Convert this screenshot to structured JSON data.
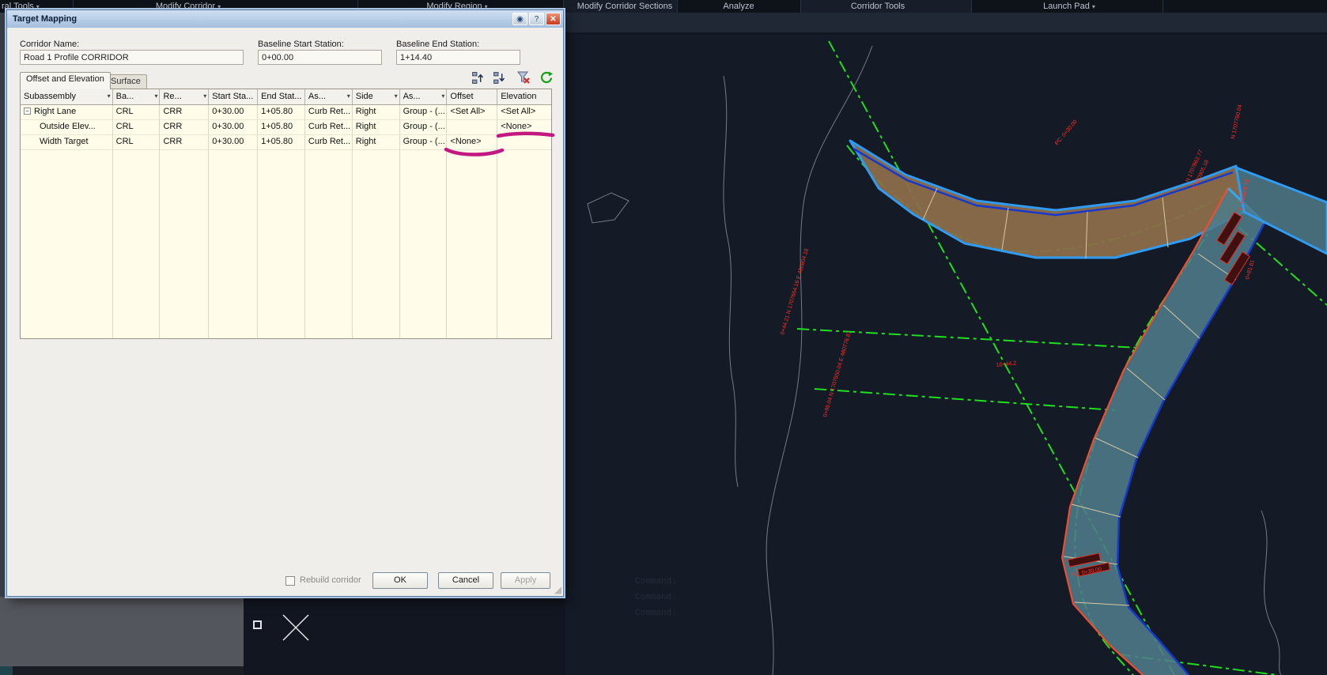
{
  "ribbon": {
    "items": [
      {
        "label": "ral Tools",
        "arrow": "▾"
      },
      {
        "label": "Modify Corridor",
        "arrow": "▾"
      },
      {
        "label": "Modify Region",
        "arrow": "▾"
      },
      {
        "label": "Modify Corridor Sections",
        "arrow": ""
      },
      {
        "label": "Analyze",
        "arrow": ""
      },
      {
        "label": "Corridor Tools",
        "arrow": ""
      },
      {
        "label": "Launch Pad",
        "arrow": "▾"
      }
    ]
  },
  "dialog": {
    "title": "Target Mapping",
    "titlebar_icons": {
      "extra": "◉",
      "help": "?",
      "close": "✕"
    },
    "fields": {
      "corridor_name_label": "Corridor Name:",
      "corridor_name_value": "Road 1 Profile CORRIDOR",
      "baseline_start_label": "Baseline Start Station:",
      "baseline_start_value": "0+00.00",
      "baseline_end_label": "Baseline End Station:",
      "baseline_end_value": "1+14.40"
    },
    "tabs": [
      {
        "label": "Offset and Elevation"
      },
      {
        "label": "Surface"
      }
    ],
    "table": {
      "columns": [
        {
          "label": "Subassembly",
          "arrow": "▾"
        },
        {
          "label": "Ba...",
          "arrow": "▾"
        },
        {
          "label": "Re...",
          "arrow": "▾"
        },
        {
          "label": "Start Sta...",
          "arrow": ""
        },
        {
          "label": "End Stat...",
          "arrow": ""
        },
        {
          "label": "As...",
          "arrow": "▾"
        },
        {
          "label": "Side",
          "arrow": "▾"
        },
        {
          "label": "As...",
          "arrow": "▾"
        },
        {
          "label": "Offset",
          "arrow": ""
        },
        {
          "label": "Elevation",
          "arrow": ""
        }
      ],
      "rows": [
        {
          "name": "Right Lane",
          "cells": [
            "CRL",
            "CRR",
            "0+30.00",
            "1+05.80",
            "Curb Ret...",
            "Right",
            "Group - (...",
            "<Set All>",
            "<Set All>"
          ]
        },
        {
          "name": "Outside Elev...",
          "cells": [
            "CRL",
            "CRR",
            "0+30.00",
            "1+05.80",
            "Curb Ret...",
            "Right",
            "Group - (...",
            "",
            "<None>"
          ]
        },
        {
          "name": "Width Target",
          "cells": [
            "CRL",
            "CRR",
            "0+30.00",
            "1+05.80",
            "Curb Ret...",
            "Right",
            "Group - (...",
            "<None>",
            ""
          ]
        }
      ]
    },
    "footer": {
      "rebuild_label": "Rebuild corridor",
      "ok": "OK",
      "cancel": "Cancel",
      "apply": "Apply"
    }
  },
  "canvas": {
    "labels": [
      "PC: 0+30.00",
      "N 1707862.77",
      "E 480905.18",
      "0+44.21  N 1707664.16  E 480804.18",
      "0+95.04  N 1707550.04  E 480776.81",
      "10+44.2",
      "PC: 0+30.00",
      "N 1707760.04",
      "E 480805.16",
      "0+81.61"
    ],
    "command_lines": [
      "Command:",
      "Command:",
      "Command:"
    ]
  },
  "colors": {
    "annotation_magenta": "#c2187f",
    "corridor_brown": "#8a6d49",
    "corridor_teal": "#4f7b8a",
    "alignment_green": "#1ee01e",
    "edge_blue": "#1738cc",
    "selection_cyan": "#2f9bf2",
    "label_red": "#ff3326"
  }
}
